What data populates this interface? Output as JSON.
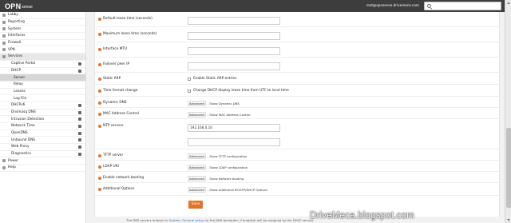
{
  "topbar": {
    "logo_opn": "OPN",
    "logo_sense": "sense",
    "user": "root@opnsense.drivemeca.com",
    "search_placeholder": ""
  },
  "sidebar": {
    "items": [
      {
        "label": "Lobby"
      },
      {
        "label": "Reporting"
      },
      {
        "label": "System"
      },
      {
        "label": "Interfaces"
      },
      {
        "label": "Firewall"
      },
      {
        "label": "VPN"
      },
      {
        "label": "Services"
      },
      {
        "label": "Captive Portal"
      },
      {
        "label": "DHCP"
      },
      {
        "label": "Server"
      },
      {
        "label": "Relay"
      },
      {
        "label": "Leases"
      },
      {
        "label": "Log File"
      },
      {
        "label": "DHCPv6"
      },
      {
        "label": "Dnsmasq DNS"
      },
      {
        "label": "Intrusion Detection"
      },
      {
        "label": "Network Time"
      },
      {
        "label": "OpenDNS"
      },
      {
        "label": "Unbound DNS"
      },
      {
        "label": "Web Proxy"
      },
      {
        "label": "Diagnostics"
      },
      {
        "label": "Power"
      },
      {
        "label": "Help"
      }
    ]
  },
  "form": {
    "default_lease": "Default lease time (seconds)",
    "max_lease": "Maximum lease time (seconds)",
    "interface_mtu": "Interface MTU",
    "failover_peer": "Failover peer IP",
    "static_arp": "Static ARP",
    "static_arp_check": "Enable Static ARP entries",
    "time_format": "Time format change",
    "time_format_check": "Change DHCP display lease time from UTC to local time",
    "dynamic_dns": "Dynamic DNS",
    "dynamic_dns_link": "- Show Dynamic DNS",
    "mac_control": "MAC Address Control",
    "mac_control_link": "- Show MAC Address Control",
    "ntp_servers": "NTP servers",
    "ntp_value": "192.168.0.10",
    "tftp_server": "TFTP server",
    "tftp_link": "- Show TFTP configuration",
    "ldap_uri": "LDAP URI",
    "ldap_link": "- Show LDAP configuration",
    "netboot": "Enable network booting",
    "netboot_link": "- Show Network booting",
    "additional": "Additional Options",
    "additional_link": "- Show Additional BOOTP/DHCP Options",
    "advanced_tag": "Advanced",
    "save_label": "Save"
  },
  "footnote": {
    "text_a": "The DNS servers entered in ",
    "link": "System: General setup",
    "text_b": " (or the DNS forwarder, if enabled) will be assigned by the DHCP service."
  },
  "watermark": "DriveMeca.blogspot.com"
}
